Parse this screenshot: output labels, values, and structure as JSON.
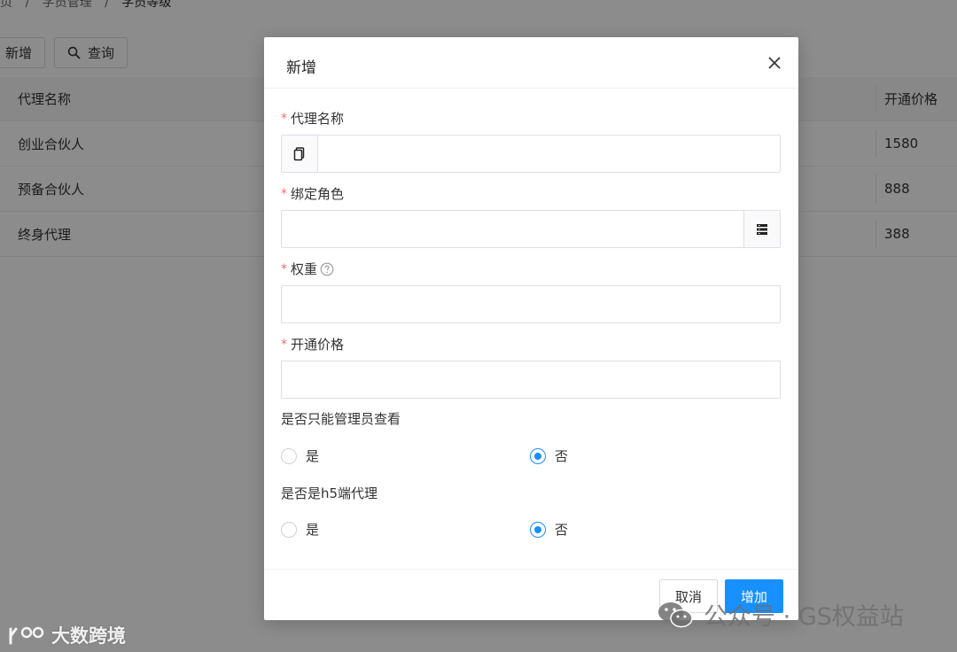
{
  "breadcrumb": {
    "items": [
      "页",
      "/",
      "学员管理",
      "/",
      "学员等级"
    ]
  },
  "toolbar": {
    "add_label": "新增",
    "query_label": "查询"
  },
  "table": {
    "columns": {
      "name": "代理名称",
      "price": "开通价格"
    },
    "rows": [
      {
        "name": "创业合伙人",
        "price": "1580"
      },
      {
        "name": "预备合伙人",
        "price": "888"
      },
      {
        "name": "终身代理",
        "price": "388"
      }
    ]
  },
  "modal": {
    "title": "新增",
    "fields": {
      "agent_name": {
        "label": "代理名称",
        "required_mark": "*",
        "value": ""
      },
      "bind_role": {
        "label": "绑定角色",
        "required_mark": "*",
        "value": ""
      },
      "weight": {
        "label": "权重",
        "required_mark": "*",
        "value": ""
      },
      "open_price": {
        "label": "开通价格",
        "required_mark": "*",
        "value": ""
      }
    },
    "admin_only": {
      "label": "是否只能管理员查看",
      "options": [
        "是",
        "否"
      ],
      "selected": "否"
    },
    "h5_agent": {
      "label": "是否是h5端代理",
      "options": [
        "是",
        "否"
      ],
      "selected": "否"
    },
    "cancel_label": "取消",
    "submit_label": "增加"
  },
  "watermark": {
    "left": "大数跨境",
    "right": "公众号 · GS权益站"
  },
  "colors": {
    "primary": "#1890ff",
    "required": "#f56c6c",
    "overlay": "rgba(0,0,0,0.45)"
  }
}
